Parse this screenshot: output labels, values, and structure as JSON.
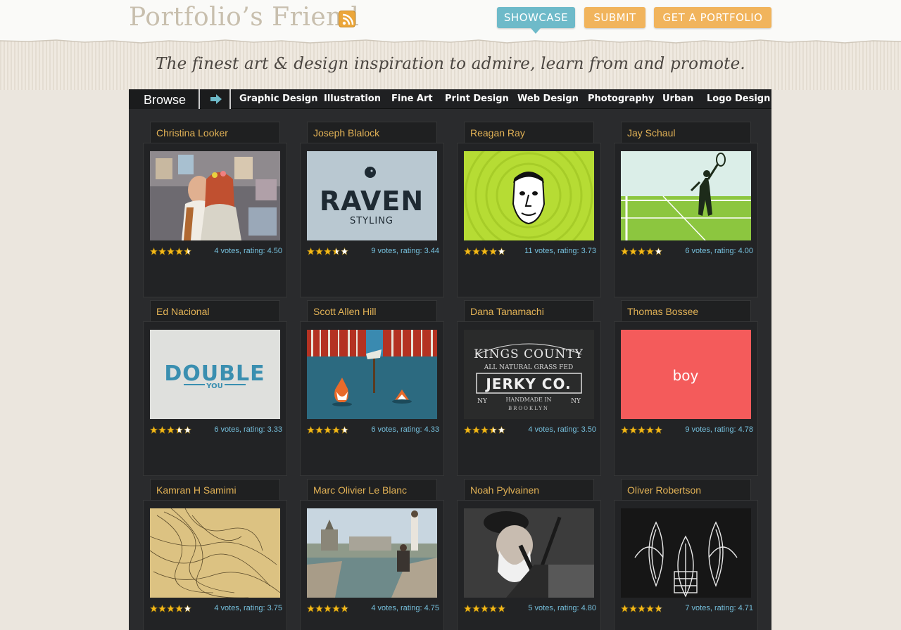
{
  "header": {
    "logo": "Portfolio’s Friend",
    "nav": {
      "showcase": "SHOWCASE",
      "submit": "SUBMIT",
      "get_portfolio": "GET A PORTFOLIO"
    },
    "tagline": "The finest art & design inspiration to admire, learn from and promote."
  },
  "category_bar": {
    "browse_label": "Browse",
    "categories": [
      "Graphic Design",
      "Illustration",
      "Fine Art",
      "Print Design",
      "Web Design",
      "Photography",
      "Urban",
      "Logo Design"
    ]
  },
  "colors": {
    "accent_blue": "#6ebac9",
    "accent_orange": "#f1b45c",
    "name_gold": "#e2b256",
    "rating_blue": "#76c0dd"
  },
  "thumbnail_texts": {
    "raven_title": "RAVEN",
    "raven_sub": "STYLING",
    "double_title": "DOUBLE",
    "double_sub": "YOU",
    "kings_county": "KINGS COUNTY",
    "grass_fed": "ALL NATURAL  GRASS FED",
    "jerky": "JERKY CO.",
    "handmade": "HANDMADE IN",
    "brooklyn": "BROOKLYN",
    "ny_left": "NY",
    "ny_right": "NY",
    "boy": "boy"
  },
  "portfolios": [
    {
      "name": "Christina Looker",
      "rating_text": "4 votes, rating: 4.50",
      "stars": 4.5,
      "thumb_icon": "photo-couple"
    },
    {
      "name": "Joseph Blalock",
      "rating_text": "9 votes, rating: 3.44",
      "stars": 3.44,
      "thumb_icon": "raven-logo"
    },
    {
      "name": "Reagan Ray",
      "rating_text": "11 votes, rating: 3.73",
      "stars": 3.73,
      "thumb_icon": "face-illustration"
    },
    {
      "name": "Jay Schaul",
      "rating_text": "6 votes, rating: 4.00",
      "stars": 4.0,
      "thumb_icon": "tennis-illustration"
    },
    {
      "name": "Ed Nacional",
      "rating_text": "6 votes, rating: 3.33",
      "stars": 3.33,
      "thumb_icon": "double-you-type"
    },
    {
      "name": "Scott Allen Hill",
      "rating_text": "6 votes, rating: 4.33",
      "stars": 4.33,
      "thumb_icon": "fox-illustration"
    },
    {
      "name": "Dana Tanamachi",
      "rating_text": "4 votes, rating: 3.50",
      "stars": 3.5,
      "thumb_icon": "chalk-lettering"
    },
    {
      "name": "Thomas Bossee",
      "rating_text": "9 votes, rating: 4.78",
      "stars": 4.78,
      "thumb_icon": "boy-type"
    },
    {
      "name": "Kamran H Samimi",
      "rating_text": "4 votes, rating: 3.75",
      "stars": 3.75,
      "thumb_icon": "line-drawing"
    },
    {
      "name": "Marc Olivier Le Blanc",
      "rating_text": "4 votes, rating: 4.75",
      "stars": 4.75,
      "thumb_icon": "paris-photo"
    },
    {
      "name": "Noah Pylvainen",
      "rating_text": "5 votes, rating: 4.80",
      "stars": 4.8,
      "thumb_icon": "bagpiper-photo"
    },
    {
      "name": "Oliver Robertson",
      "rating_text": "7 votes, rating: 4.71",
      "stars": 4.71,
      "thumb_icon": "ornament-illustration"
    }
  ]
}
